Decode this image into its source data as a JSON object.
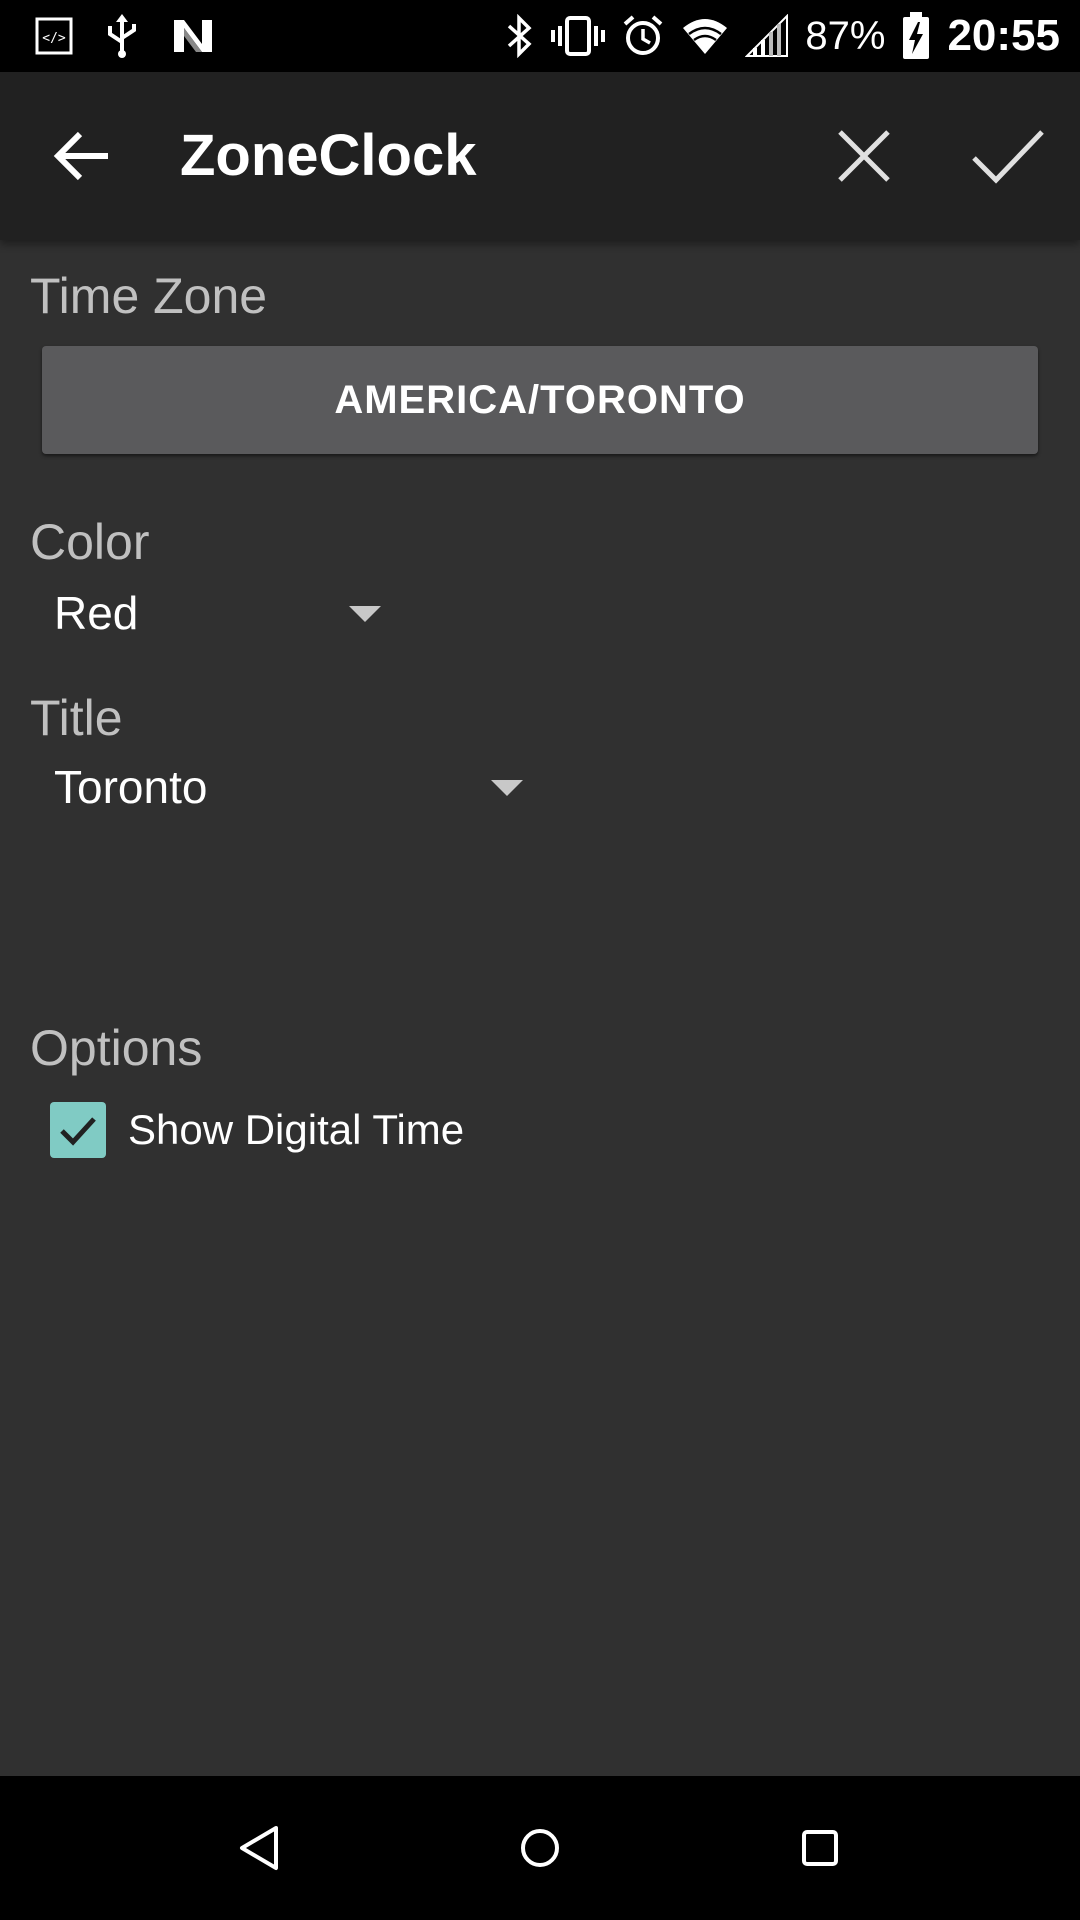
{
  "status_bar": {
    "battery": "87%",
    "time": "20:55",
    "left_icons": [
      "code-icon",
      "usb-icon",
      "n-logo-icon"
    ],
    "right_icons": [
      "bluetooth-icon",
      "vibrate-icon",
      "alarm-icon",
      "wifi-icon",
      "signal-icon",
      "battery-charging-icon"
    ]
  },
  "toolbar": {
    "title": "ZoneClock",
    "back_icon": "arrow-left-icon",
    "cancel_icon": "close-icon",
    "confirm_icon": "check-icon"
  },
  "time_zone": {
    "label": "Time Zone",
    "button": "AMERICA/TORONTO"
  },
  "color": {
    "label": "Color",
    "value": "Red"
  },
  "title": {
    "label": "Title",
    "value": "Toronto"
  },
  "options": {
    "label": "Options",
    "show_digital_time": {
      "label": "Show Digital Time",
      "checked": true
    }
  },
  "colors": {
    "background": "#303030",
    "toolbar": "#212121",
    "button": "#5a5a5c",
    "accent": "#80cbc4"
  },
  "nav_bar": {
    "icons": [
      "back-triangle-icon",
      "home-circle-icon",
      "recents-square-icon"
    ]
  }
}
